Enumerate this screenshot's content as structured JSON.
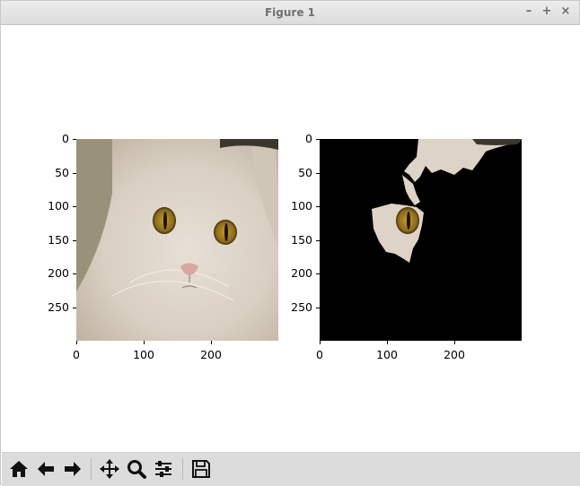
{
  "window": {
    "title": "Figure 1"
  },
  "window_controls": {
    "minimize": "–",
    "maximize": "+",
    "close": "×"
  },
  "figure": {
    "left_axes": {
      "content": "photo of a white fluffy cat with amber eyes",
      "yticks": [
        "0",
        "50",
        "100",
        "150",
        "200",
        "250"
      ],
      "xticks": [
        "0",
        "100",
        "200"
      ]
    },
    "right_axes": {
      "content": "masked cat image: only eye region and tufts of fur visible on black",
      "yticks": [
        "0",
        "50",
        "100",
        "150",
        "200",
        "250"
      ],
      "xticks": [
        "0",
        "100",
        "200"
      ]
    }
  },
  "toolbar": {
    "buttons": [
      {
        "name": "home",
        "icon": "home-icon"
      },
      {
        "name": "back",
        "icon": "arrow-left-icon"
      },
      {
        "name": "forward",
        "icon": "arrow-right-icon"
      },
      {
        "name": "pan",
        "icon": "move-icon"
      },
      {
        "name": "zoom",
        "icon": "magnifier-icon"
      },
      {
        "name": "configure-subplots",
        "icon": "sliders-icon"
      },
      {
        "name": "save",
        "icon": "floppy-disk-icon"
      }
    ]
  },
  "colors": {
    "background": "#ffffff",
    "toolbar": "#dcdcdc",
    "mask": "#000000",
    "fur": "#ddd3c6"
  }
}
